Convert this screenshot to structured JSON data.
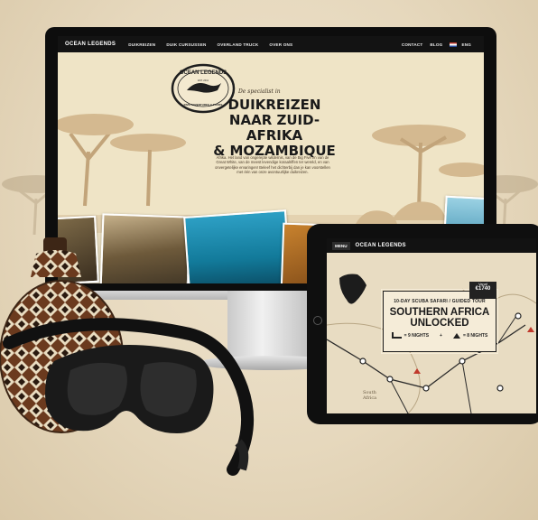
{
  "site": {
    "brand": "OCEAN LEGENDS",
    "nav_items": [
      "DUIKREIZEN",
      "DUIK CURSUSSEN",
      "OVERLAND TRUCK",
      "OVER ONS"
    ],
    "nav_right": [
      "CONTACT",
      "BLOG"
    ],
    "language": "ENG",
    "logo_text": "OCEAN LEGENDS",
    "logo_sub": "DIVE ADVENTURES & TOURS",
    "logo_est": "EST. 2011",
    "tagline": "De specialist in",
    "headline": [
      "DUIKREIZEN",
      "NAAR ZUID-AFRIKA",
      "& MOZAMBIQUE"
    ],
    "body": "Afrika. Het land van ongerepte wildernis, van de Big Five en van de Great White, van de meest levendige koraalriffen ter wereld, en van onvergetelijke ervaringen! Beleef het dichterbij dan je kan voorstellen met één van onze avontuurlijke duikreizen."
  },
  "tablet": {
    "menu_label": "MENU",
    "brand": "OCEAN LEGENDS",
    "price_from": "Vanaf",
    "price_value": "€1740",
    "card_sub": "10-DAY SCUBA SAFARI / GUIDED TOUR",
    "card_title": [
      "SOUTHERN AFRICA",
      "UNLOCKED"
    ],
    "nights_a": "= 9 NIGHTS",
    "nights_plus": "+",
    "nights_b": "= 8 NIGHTS",
    "map_label": [
      "South",
      "Africa"
    ]
  }
}
